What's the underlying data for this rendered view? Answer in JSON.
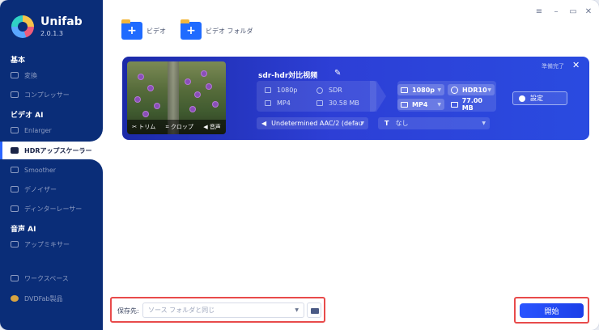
{
  "app": {
    "name": "Unifab",
    "version": "2.0.1.3"
  },
  "sidebar": {
    "sections": [
      {
        "label": "基本"
      },
      {
        "label": "ビデオ AI"
      },
      {
        "label": "音声 AI"
      }
    ],
    "items": [
      {
        "label": "変換"
      },
      {
        "label": "コンプレッサー"
      },
      {
        "label": "Enlarger"
      },
      {
        "label": "HDRアップスケーラー"
      },
      {
        "label": "Smoother"
      },
      {
        "label": "デノイザー"
      },
      {
        "label": "ディンターレーサー"
      },
      {
        "label": "アップミキサー"
      },
      {
        "label": "ワークスペース"
      },
      {
        "label": "DVDFab製品"
      }
    ]
  },
  "window_controls": {
    "menu": "≡",
    "minimize": "–",
    "maximize": "▭",
    "close": "✕"
  },
  "toolbar": {
    "add_video": "ビデオ",
    "add_folder": "ビデオ フォルダ",
    "plus": "+"
  },
  "task": {
    "title": "sdr-hdr対比视频",
    "status": "準備完了",
    "thumb_actions": {
      "trim": "トリム",
      "crop": "クロップ",
      "audio": "音声"
    },
    "source": {
      "resolution": "1080p",
      "dynamic_range": "SDR",
      "format": "MP4",
      "size": "30.58 MB"
    },
    "output": {
      "resolution": "1080p",
      "dynamic_range": "HDR10",
      "format": "MP4",
      "size": "77.00 MB"
    },
    "settings_label": "設定",
    "audio_track": "Undetermined AAC/2 (defau",
    "subtitle": "なし"
  },
  "bottom": {
    "save_label": "保存先:",
    "save_placeholder": "ソース フォルダと同じ",
    "start_label": "開始"
  },
  "colors": {
    "sidebar_bg": "#0a2d78",
    "card_bg": "#2d3fd6",
    "accent": "#2a55ff",
    "highlight": "#e84b4b"
  }
}
